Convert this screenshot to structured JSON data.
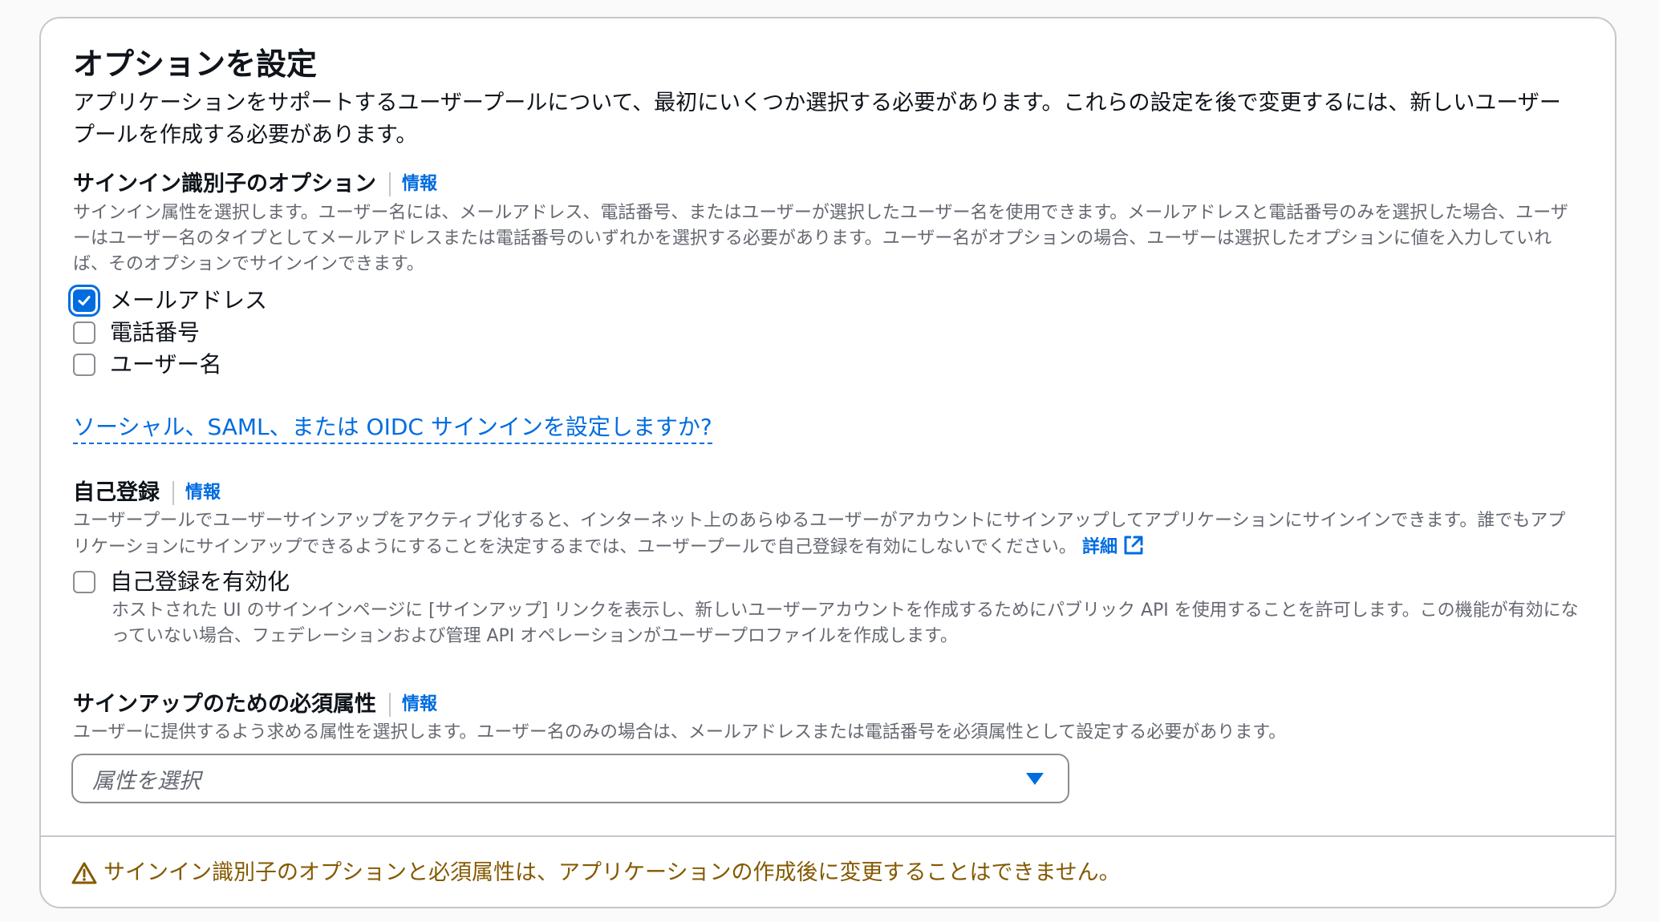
{
  "panel": {
    "title": "オプションを設定",
    "description": "アプリケーションをサポートするユーザープールについて、最初にいくつか選択する必要があります。これらの設定を後で変更するには、新しいユーザープールを作成する必要があります。"
  },
  "sign_in": {
    "label": "サインイン識別子のオプション",
    "info": "情報",
    "description": "サインイン属性を選択します。ユーザー名には、メールアドレス、電話番号、またはユーザーが選択したユーザー名を使用できます。メールアドレスと電話番号のみを選択した場合、ユーザーはユーザー名のタイプとしてメールアドレスまたは電話番号のいずれかを選択する必要があります。ユーザー名がオプションの場合、ユーザーは選択したオプションに値を入力していれば、そのオプションでサインインできます。",
    "options": [
      {
        "label": "メールアドレス",
        "checked": true
      },
      {
        "label": "電話番号",
        "checked": false
      },
      {
        "label": "ユーザー名",
        "checked": false
      }
    ],
    "federation_link": "ソーシャル、SAML、または OIDC サインインを設定しますか?"
  },
  "self_registration": {
    "label": "自己登録",
    "info": "情報",
    "description": "ユーザープールでユーザーサインアップをアクティブ化すると、インターネット上のあらゆるユーザーがアカウントにサインアップしてアプリケーションにサインインできます。誰でもアプリケーションにサインアップできるようにすることを決定するまでは、ユーザープールで自己登録を有効にしないでください。",
    "learn_more": "詳細",
    "checkbox_label": "自己登録を有効化",
    "checkbox_checked": false,
    "checkbox_description": "ホストされた UI のサインインページに [サインアップ] リンクを表示し、新しいユーザーアカウントを作成するためにパブリック API を使用することを許可します。この機能が有効になっていない場合、フェデレーションおよび管理 API オペレーションがユーザープロファイルを作成します。"
  },
  "required_attributes": {
    "label": "サインアップのための必須属性",
    "info": "情報",
    "description": "ユーザーに提供するよう求める属性を選択します。ユーザー名のみの場合は、メールアドレスまたは電話番号を必須属性として設定する必要があります。",
    "select_placeholder": "属性を選択"
  },
  "footer": {
    "warning": "サインイン識別子のオプションと必須属性は、アプリケーションの作成後に変更することはできません。"
  },
  "colors": {
    "accent": "#006ce0",
    "warning": "#855900",
    "border": "#c6c6cd",
    "secondary_text": "#656871"
  }
}
